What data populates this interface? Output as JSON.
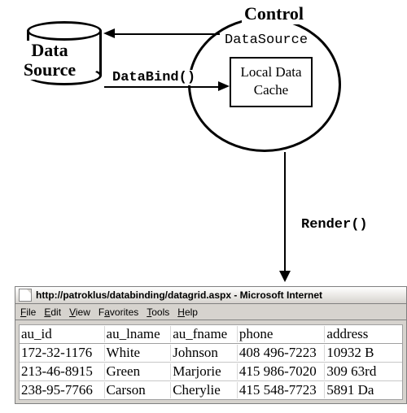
{
  "diagram": {
    "data_source_label": "Data\nSource",
    "control_title": "Control",
    "datasource_prop": "DataSource",
    "cache_label": "Local Data\nCache",
    "databind_call": "DataBind()",
    "render_call": "Render()"
  },
  "browser": {
    "title": "http://patroklus/databinding/datagrid.aspx - Microsoft Internet",
    "menu": [
      "File",
      "Edit",
      "View",
      "Favorites",
      "Tools",
      "Help"
    ],
    "grid": {
      "headers": [
        "au_id",
        "au_lname",
        "au_fname",
        "phone",
        "address"
      ],
      "rows": [
        [
          "172-32-1176",
          "White",
          "Johnson",
          "408 496-7223",
          "10932 B"
        ],
        [
          "213-46-8915",
          "Green",
          "Marjorie",
          "415 986-7020",
          "309 63rd"
        ],
        [
          "238-95-7766",
          "Carson",
          "Cherylie",
          "415 548-7723",
          "5891 Da"
        ]
      ]
    }
  }
}
